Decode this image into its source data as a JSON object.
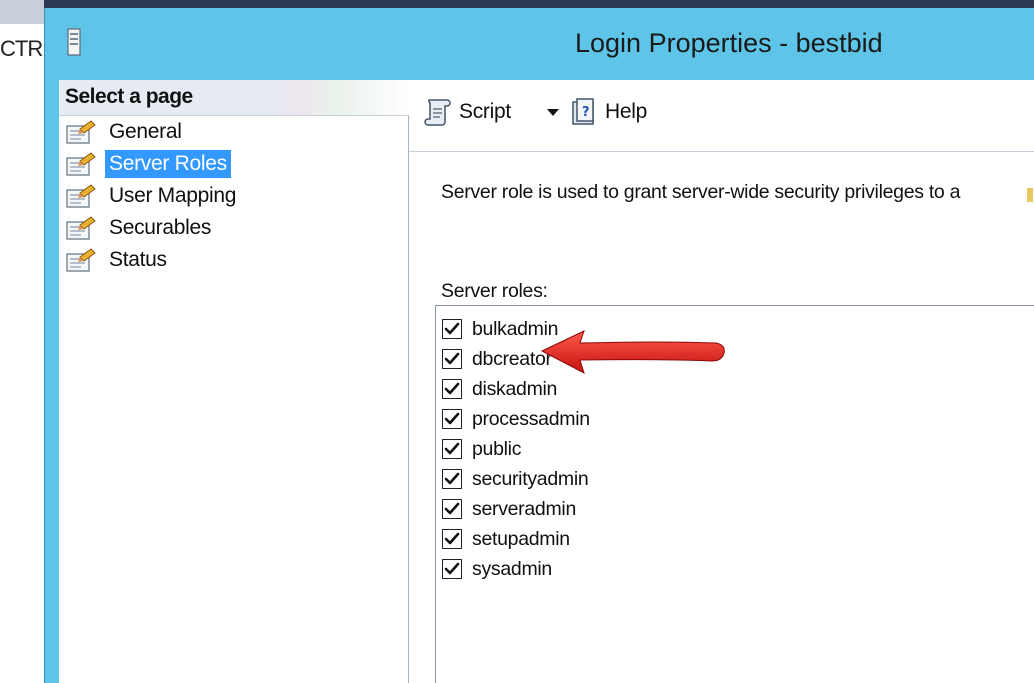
{
  "background_app": {
    "partial_text": "CTR"
  },
  "window": {
    "title": "Login Properties - bestbid"
  },
  "nav": {
    "header": "Select a page",
    "items": [
      {
        "label": "General",
        "selected": false
      },
      {
        "label": "Server Roles",
        "selected": true
      },
      {
        "label": "User Mapping",
        "selected": false
      },
      {
        "label": "Securables",
        "selected": false
      },
      {
        "label": "Status",
        "selected": false
      }
    ]
  },
  "toolbar": {
    "script_label": "Script",
    "help_label": "Help"
  },
  "main": {
    "description": "Server role is used to grant server-wide security privileges to a",
    "roles_label": "Server roles:",
    "roles": [
      {
        "name": "bulkadmin",
        "checked": true
      },
      {
        "name": "dbcreator",
        "checked": true
      },
      {
        "name": "diskadmin",
        "checked": true
      },
      {
        "name": "processadmin",
        "checked": true
      },
      {
        "name": "public",
        "checked": true
      },
      {
        "name": "securityadmin",
        "checked": true
      },
      {
        "name": "serveradmin",
        "checked": true
      },
      {
        "name": "setupadmin",
        "checked": true
      },
      {
        "name": "sysadmin",
        "checked": true
      }
    ]
  },
  "colors": {
    "title_bar": "#5ec4e8",
    "selection": "#3399ff",
    "annotation_arrow": "#e01b1b"
  }
}
